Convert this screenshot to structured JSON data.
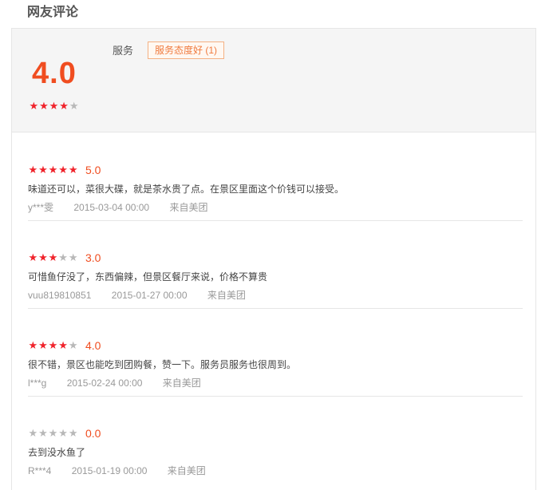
{
  "section_title": "网友评论",
  "summary": {
    "score": "4.0",
    "stars": 4,
    "tag_label": "服务",
    "tag": "服务态度好 (1)"
  },
  "reviews": [
    {
      "stars": 5,
      "score": "5.0",
      "content": "味道还可以，菜很大碟，就是茶水贵了点。在景区里面这个价钱可以接受。",
      "user": "y***雯",
      "date": "2015-03-04 00:00",
      "source": "来自美团"
    },
    {
      "stars": 3,
      "score": "3.0",
      "content": "可惜鱼仔没了，东西偏辣，但景区餐厅来说，价格不算贵",
      "user": "vuu819810851",
      "date": "2015-01-27 00:00",
      "source": "来自美团"
    },
    {
      "stars": 4,
      "score": "4.0",
      "content": "很不错，景区也能吃到团购餐，赞一下。服务员服务也很周到。",
      "user": "l***g",
      "date": "2015-02-24 00:00",
      "source": "来自美团"
    },
    {
      "stars": 0,
      "score": "0.0",
      "content": "去到没水鱼了",
      "user": "R***4",
      "date": "2015-01-19 00:00",
      "source": "来自美团"
    }
  ],
  "colors": {
    "accent": "#f04d20",
    "star_on": "#f0232b",
    "star_off": "#b8b8b8",
    "tag_border": "#f4b183"
  },
  "icons": {
    "star": "star-icon"
  }
}
